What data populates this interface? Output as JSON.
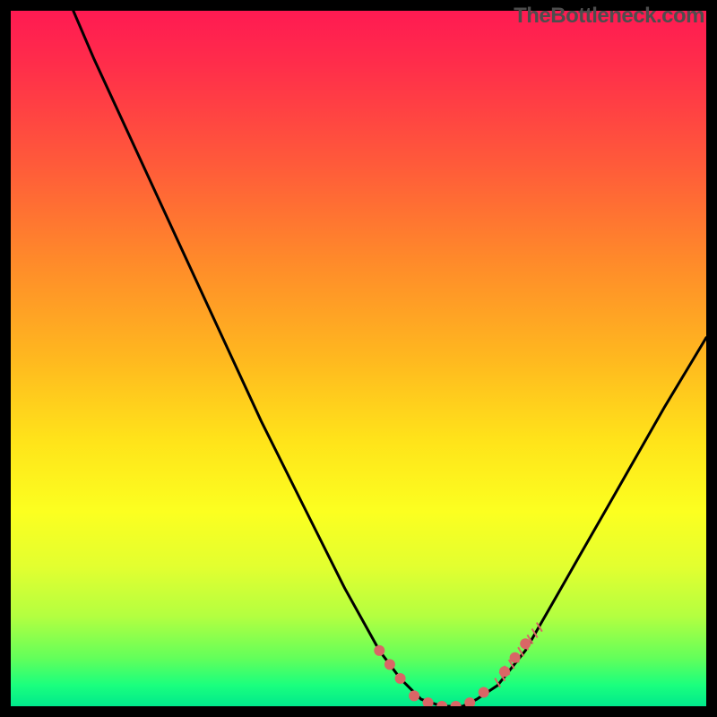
{
  "watermark": "TheBottleneck.com",
  "chart_data": {
    "type": "line",
    "title": "",
    "xlabel": "",
    "ylabel": "",
    "xlim": [
      0,
      100
    ],
    "ylim": [
      0,
      100
    ],
    "series": [
      {
        "name": "bottleneck-curve",
        "x": [
          9,
          12,
          18,
          24,
          30,
          36,
          42,
          48,
          53,
          56,
          59,
          62,
          65,
          67,
          70,
          74,
          78,
          82,
          86,
          90,
          94,
          100
        ],
        "y": [
          100,
          93,
          80,
          67,
          54,
          41,
          29,
          17,
          8,
          4,
          1,
          0,
          0,
          1,
          3,
          8,
          15,
          22,
          29,
          36,
          43,
          53
        ]
      }
    ],
    "markers": {
      "name": "highlight-dots",
      "color": "#d96666",
      "points": [
        {
          "x": 53,
          "y": 8
        },
        {
          "x": 54.5,
          "y": 6
        },
        {
          "x": 56,
          "y": 4
        },
        {
          "x": 58,
          "y": 1.5
        },
        {
          "x": 60,
          "y": 0.5
        },
        {
          "x": 62,
          "y": 0
        },
        {
          "x": 64,
          "y": 0
        },
        {
          "x": 66,
          "y": 0.5
        },
        {
          "x": 68,
          "y": 2
        },
        {
          "x": 71,
          "y": 5
        },
        {
          "x": 72.5,
          "y": 7
        },
        {
          "x": 74,
          "y": 9
        }
      ]
    },
    "hatching": {
      "name": "right-branch-hatch",
      "x_range": [
        70,
        76
      ],
      "y_range": [
        3,
        11
      ]
    }
  }
}
